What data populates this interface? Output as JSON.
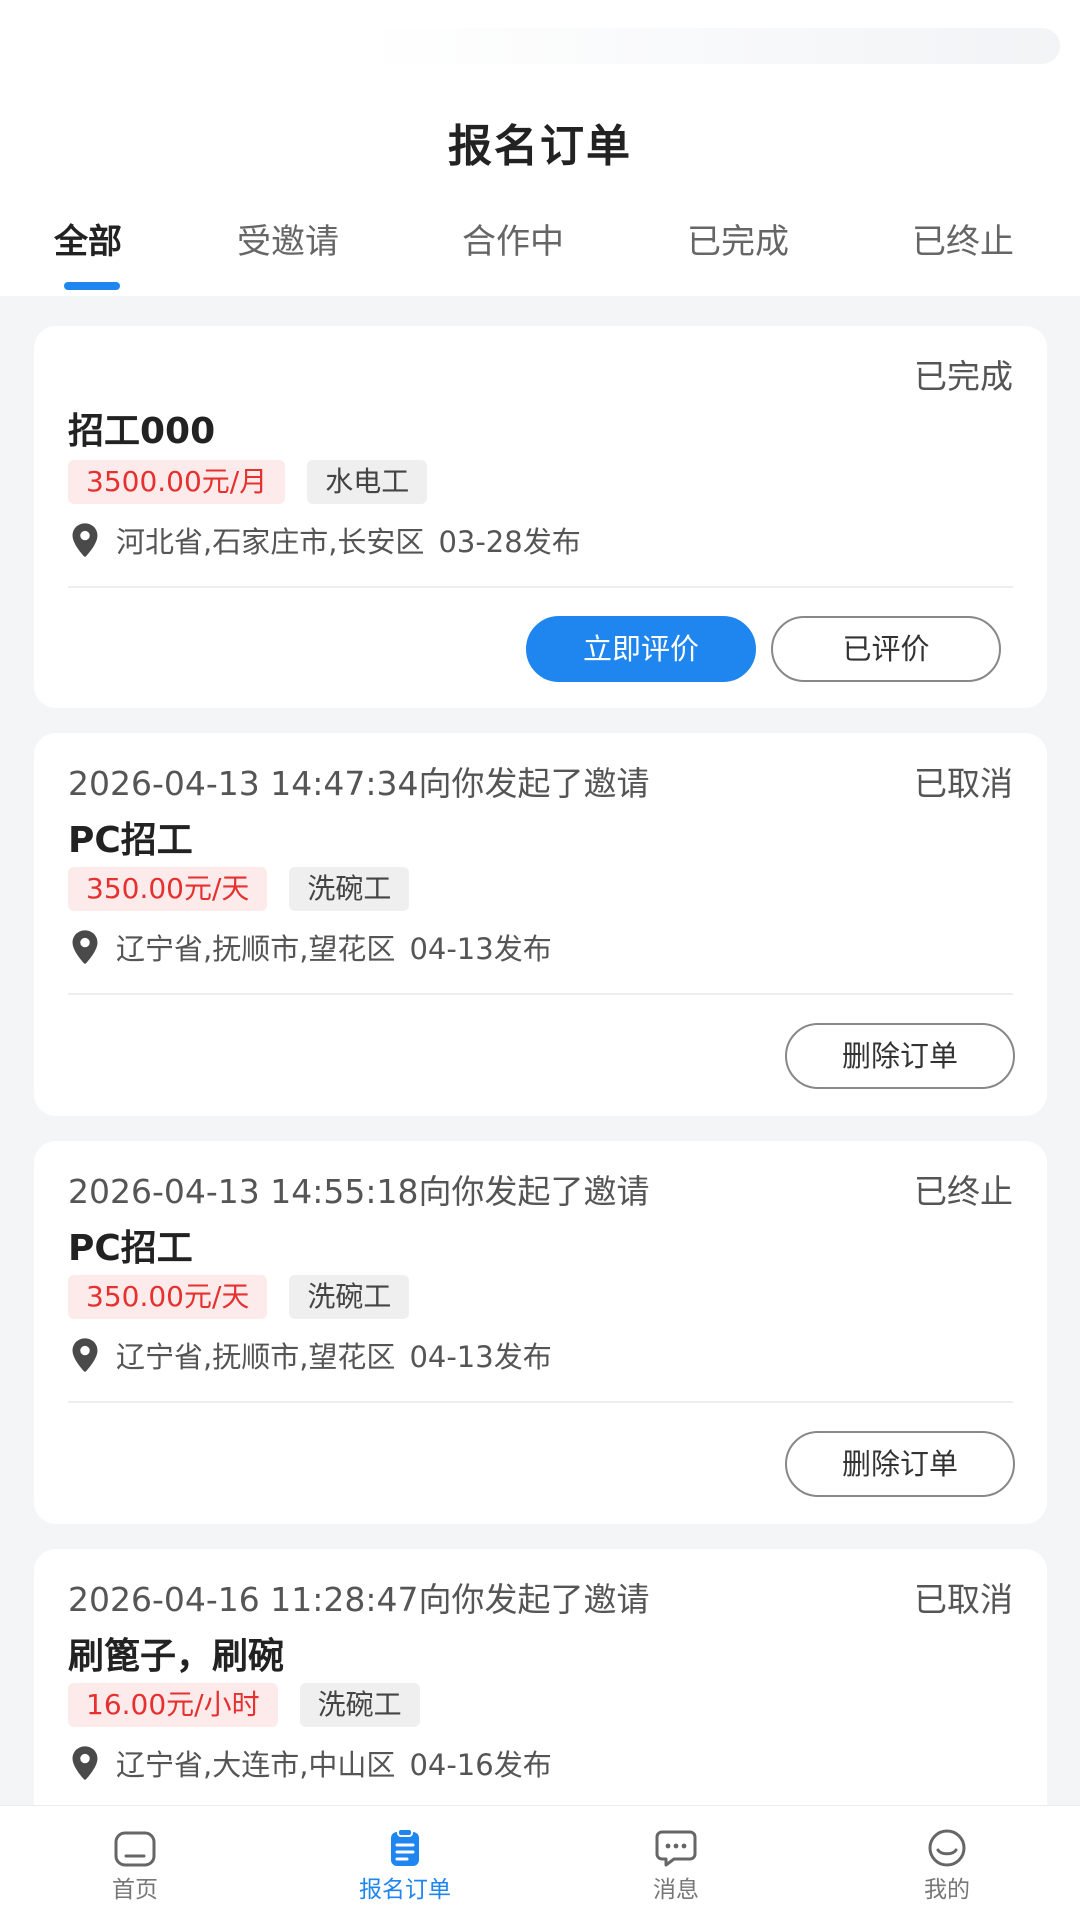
{
  "header": {
    "title": "报名订单"
  },
  "tabs": [
    {
      "label": "全部"
    },
    {
      "label": "受邀请"
    },
    {
      "label": "合作中"
    },
    {
      "label": "已完成"
    },
    {
      "label": "已终止"
    }
  ],
  "active_tab": "全部",
  "orders": [
    {
      "invite_text": "",
      "status": "已完成",
      "title": "招工000",
      "salary": "3500.00元/月",
      "job_type": "水电工",
      "location": "河北省,石家庄市,长安区",
      "publish": "03-28发布",
      "buttons": [
        "立即评价",
        "已评价"
      ]
    },
    {
      "invite_text": "2026-04-13 14:47:34向你发起了邀请",
      "status": "已取消",
      "title": "PC招工",
      "salary": "350.00元/天",
      "job_type": "洗碗工",
      "location": "辽宁省,抚顺市,望花区",
      "publish": "04-13发布",
      "buttons": [
        "删除订单"
      ]
    },
    {
      "invite_text": "2026-04-13 14:55:18向你发起了邀请",
      "status": "已终止",
      "title": "PC招工",
      "salary": "350.00元/天",
      "job_type": "洗碗工",
      "location": "辽宁省,抚顺市,望花区",
      "publish": "04-13发布",
      "buttons": [
        "删除订单"
      ]
    },
    {
      "invite_text": "2026-04-16 11:28:47向你发起了邀请",
      "status": "已取消",
      "title": "刷篦子，刷碗",
      "salary": "16.00元/小时",
      "job_type": "洗碗工",
      "location": "辽宁省,大连市,中山区",
      "publish": "04-16发布",
      "buttons": []
    }
  ],
  "bottom_nav": [
    {
      "label": "首页",
      "icon": "home-icon"
    },
    {
      "label": "报名订单",
      "icon": "clipboard-icon"
    },
    {
      "label": "消息",
      "icon": "message-icon"
    },
    {
      "label": "我的",
      "icon": "smile-icon"
    }
  ],
  "colors": {
    "accent": "#1f86f0",
    "salary": "#e5312f",
    "salary_bg": "#fdeaea"
  }
}
